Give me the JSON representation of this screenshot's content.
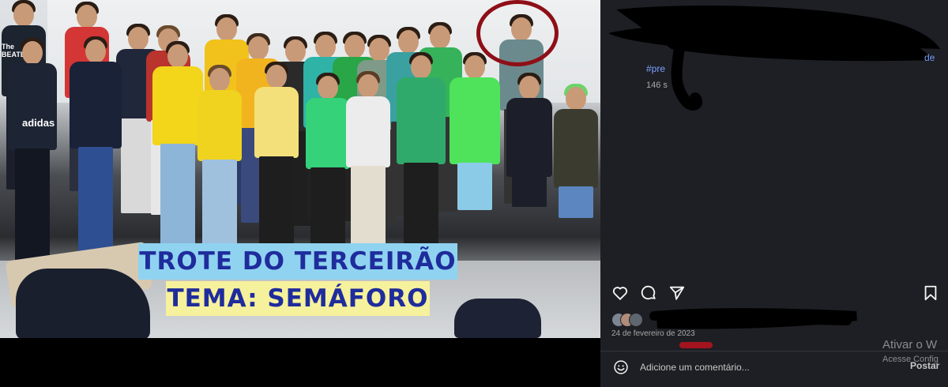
{
  "photo": {
    "caption_line1": "TROTE DO TERCEIRÃO",
    "caption_line2": "TEMA: SEMÁFORO",
    "shirt_text": "adidas",
    "shirt_text2": "The BEATLES"
  },
  "sidebar": {
    "hashtag": "#pre",
    "hashtag_right": "de",
    "likes_count": "146 s",
    "date": "24 de fevereiro de 2023",
    "comment_placeholder": "Adicione um comentário...",
    "post_label": "Postar",
    "windows_activation_title": "Ativar o W",
    "windows_activation_sub": "Acesse Config"
  },
  "icons": {
    "like": "heart-icon",
    "comment": "comment-bubble-icon",
    "share": "paper-plane-icon",
    "save": "bookmark-icon",
    "emoji": "emoji-smile-icon"
  },
  "colors": {
    "sidebar_bg": "#1e1f24",
    "caption_blue_bg": "#8fd3f0",
    "caption_yellow_bg": "#f6f19c",
    "caption_text": "#1f2c9c",
    "annotation_red": "#8e0f17"
  }
}
